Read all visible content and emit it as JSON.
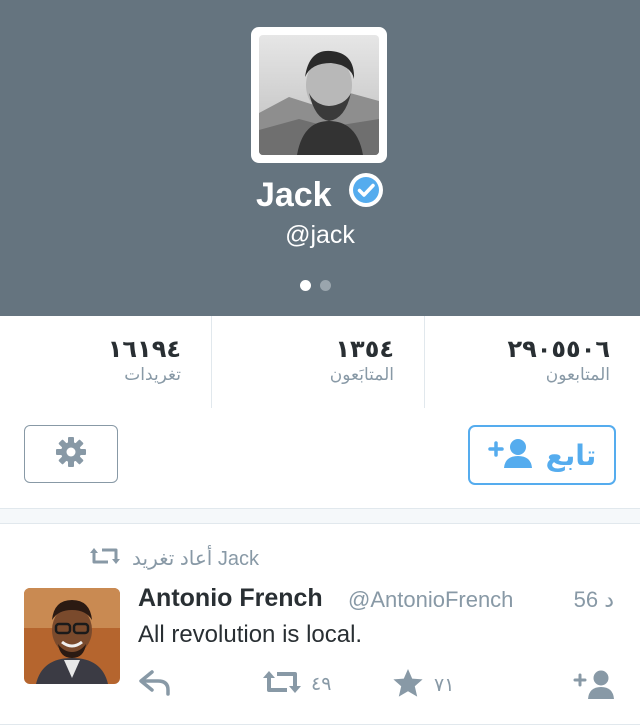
{
  "profile": {
    "name": "Jack",
    "handle": "@jack",
    "verified": true,
    "page_indicator": {
      "pages": 2,
      "current": 1
    }
  },
  "stats": {
    "tweets": {
      "value": "١٦١٩٤",
      "label": "تغريدات"
    },
    "following": {
      "value": "١٣٥٤",
      "label": "المتابَعون"
    },
    "followers": {
      "value": "٢٩٠٥٥٠٦",
      "label": "المتابعون"
    }
  },
  "actions": {
    "follow_label": "تابع",
    "settings_icon": "gear-icon",
    "follow_icon": "add-user-icon"
  },
  "tweet": {
    "retweeted_by": "Jack أعاد تغريد",
    "author_name": "Antonio French",
    "author_handle": "@AntonioFrench",
    "time": "56 د",
    "text": "All revolution is local.",
    "retweet_count": "٤٩",
    "favorite_count": "٧١"
  },
  "colors": {
    "header_bg": "#65747f",
    "accent": "#55acee",
    "muted": "#8899a6",
    "text": "#292f33"
  }
}
